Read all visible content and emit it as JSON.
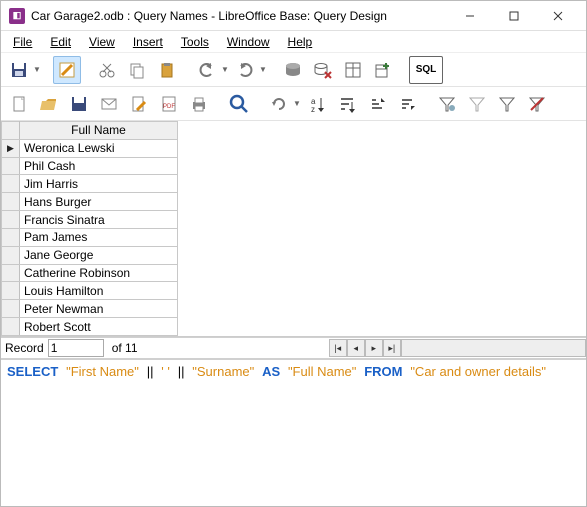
{
  "window": {
    "title": "Car Garage2.odb : Query Names - LibreOffice Base: Query Design"
  },
  "menu": {
    "file": "File",
    "edit": "Edit",
    "view": "View",
    "insert": "Insert",
    "tools": "Tools",
    "window": "Window",
    "help": "Help"
  },
  "toolbar1": {
    "save": "save",
    "edit_mode": "edit",
    "cut": "cut",
    "copy": "copy",
    "paste": "paste",
    "undo": "undo",
    "redo": "redo",
    "run": "run-query",
    "clear": "clear-query",
    "design": "design-view",
    "add_table": "add-table",
    "sql": "SQL"
  },
  "toolbar2": {
    "new_doc": "new",
    "open": "open",
    "save2": "save",
    "email": "email",
    "pdf": "pdf",
    "print": "print",
    "find": "find",
    "reload": "reload",
    "sort_auto": "sort",
    "sort_config": "sort-cfg",
    "sort_asc": "asc",
    "sort_desc": "desc",
    "filter_auto": "filter",
    "filter_std": "filter-std",
    "filter_off": "filter-off"
  },
  "grid": {
    "header": "Full Name",
    "rows": [
      "Weronica Lewski",
      "Phil Cash",
      "Jim Harris",
      "Hans Burger",
      "Francis Sinatra",
      "Pam James",
      "Jane George",
      "Catherine Robinson",
      "Louis Hamilton",
      "Peter Newman",
      "Robert Scott"
    ]
  },
  "nav": {
    "label": "Record",
    "current": "1",
    "of_label": "of",
    "total": "11"
  },
  "sql": {
    "select": "SELECT",
    "col1": "\"First Name\"",
    "concat1": "||",
    "sep": "' '",
    "concat2": "||",
    "col2": "\"Surname\"",
    "as": "AS",
    "alias": "\"Full Name\"",
    "from": "FROM",
    "table": "\"Car and owner details\""
  }
}
